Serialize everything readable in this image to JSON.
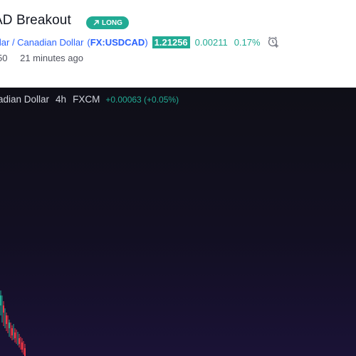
{
  "idea": {
    "title": "AD Breakout",
    "badge": "LONG",
    "symbol_name": "llar / Canadian Dollar",
    "ticker_open": "(",
    "ticker": "FX:USDCAD",
    "ticker_close": ")",
    "price": "1.21256",
    "change": "0.00211",
    "change_pct": "0.17%",
    "author_fragment": "50",
    "posted": "21 minutes ago"
  },
  "chart": {
    "symbol": "adian Dollar",
    "interval": "4h",
    "source": "FXCM",
    "delta": "+0.00063 (+0.05%)"
  },
  "colors": {
    "accent_blue": "#2962ff",
    "up_green": "#22ab94",
    "down_red": "#f23645",
    "chart_bg": "#120f22"
  },
  "icons": {
    "badge_icon": "arrow-up-right-icon",
    "alert_icon": "alarm-clock-add-icon"
  }
}
